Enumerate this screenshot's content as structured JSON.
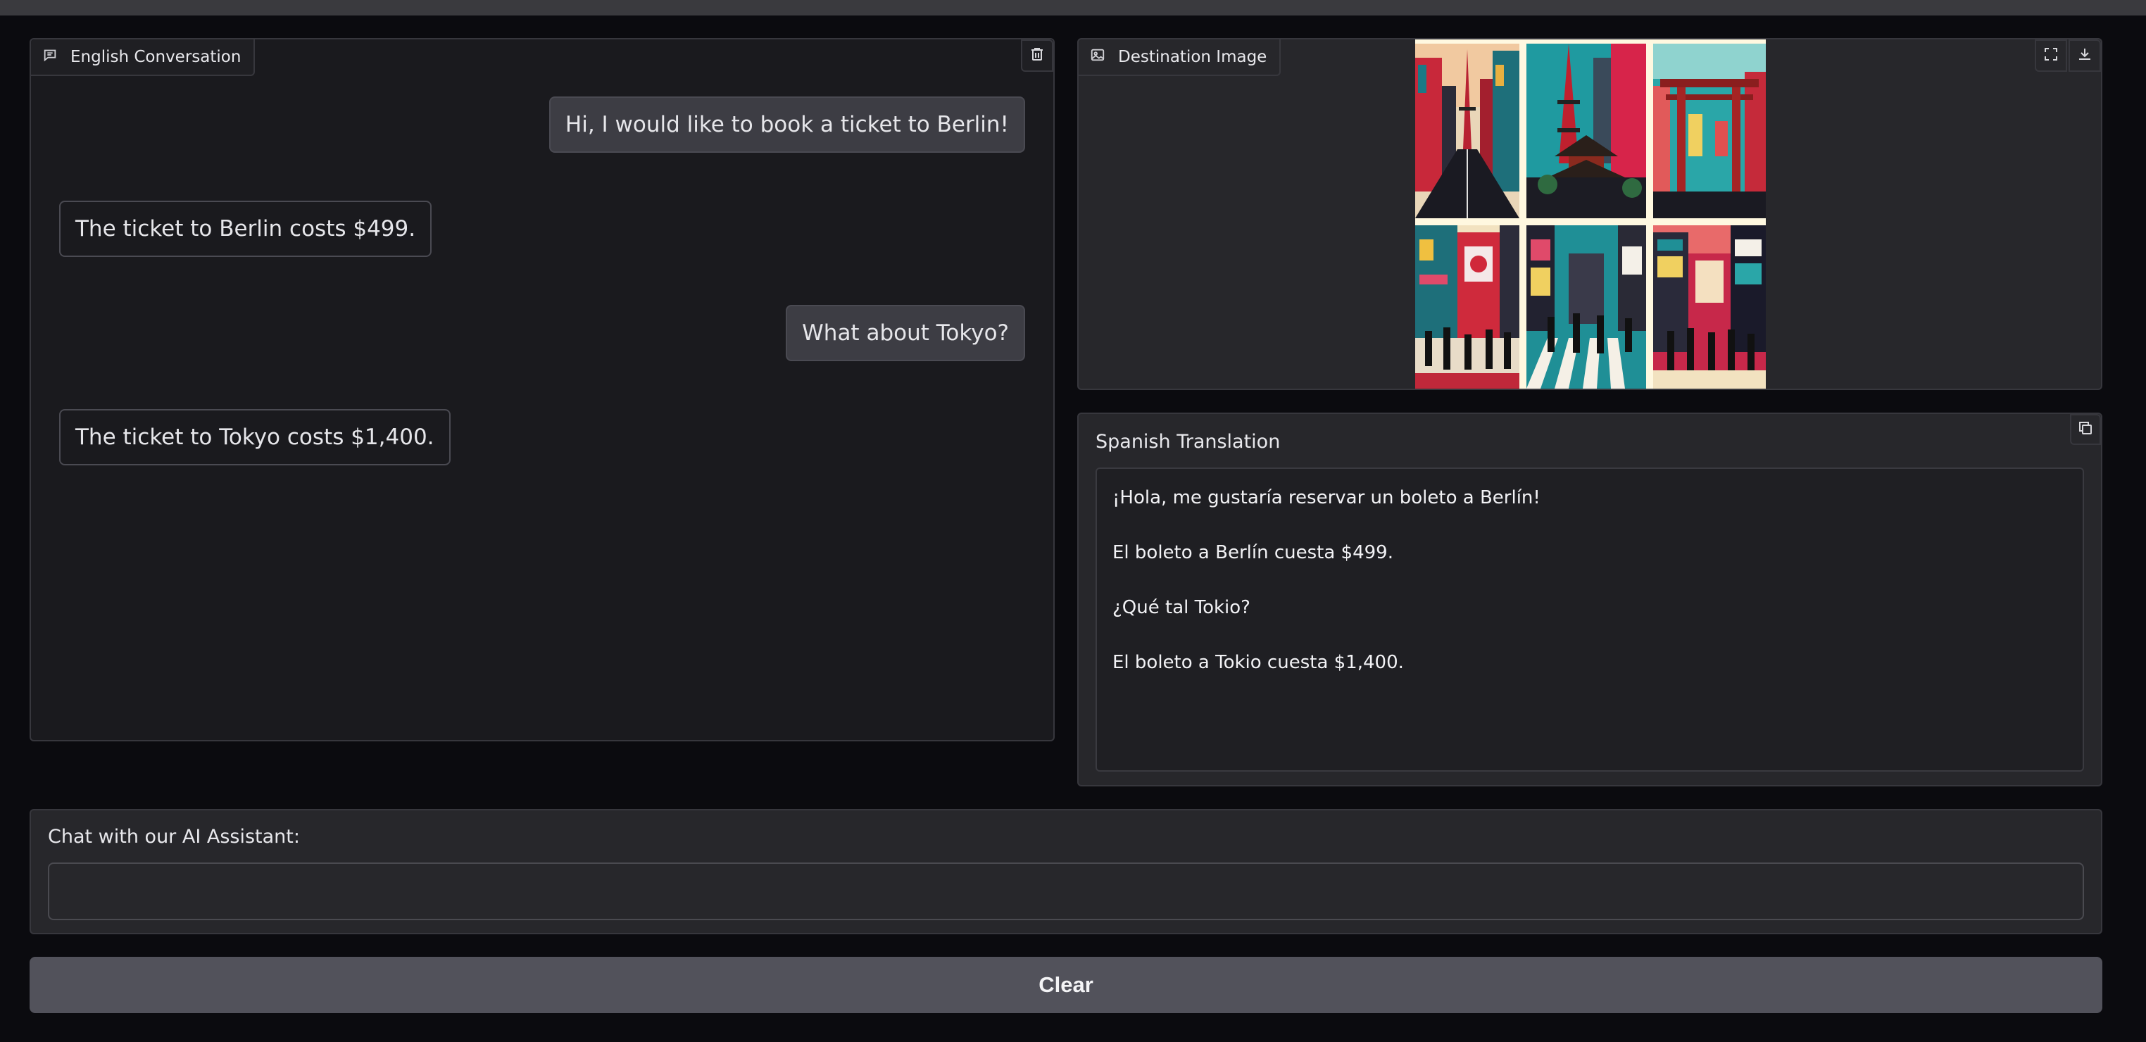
{
  "conversation": {
    "label": "English Conversation",
    "icon": "chat-icon",
    "delete_icon": "trash-icon",
    "messages": [
      {
        "role": "user",
        "text": "Hi, I would like to book a ticket to Berlin!"
      },
      {
        "role": "bot",
        "text": "The ticket to Berlin costs $499."
      },
      {
        "role": "user",
        "text": "What about Tokyo?"
      },
      {
        "role": "bot",
        "text": "The ticket to Tokyo costs $1,400."
      }
    ]
  },
  "destination": {
    "label": "Destination Image",
    "icon": "image-icon",
    "fullscreen_icon": "fullscreen-icon",
    "download_icon": "download-icon"
  },
  "translation": {
    "label": "Spanish Translation",
    "copy_icon": "copy-icon",
    "lines": [
      "¡Hola, me gustaría reservar un boleto a Berlín!",
      "El boleto a Berlín cuesta $499.",
      "¿Qué tal Tokio?",
      "El boleto a Tokio cuesta $1,400."
    ]
  },
  "chat": {
    "label": "Chat with our AI Assistant:",
    "value": "",
    "placeholder": ""
  },
  "clear_button": {
    "label": "Clear"
  },
  "colors": {
    "background": "#0b0b0f",
    "panel": "#1a1a1e",
    "panel_alt": "#27272b",
    "border": "#37373d",
    "user_bubble": "#3d3d44",
    "button": "#52525b",
    "text": "#e6e6ea"
  }
}
